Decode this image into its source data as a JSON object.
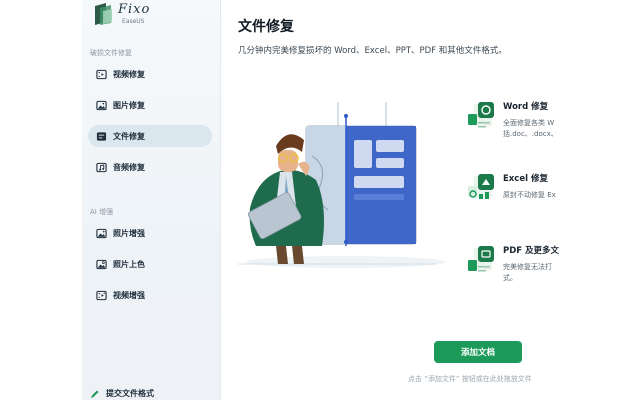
{
  "brand": {
    "name": "Fixo",
    "sub": "EaseUS"
  },
  "sidebar": {
    "section1": "破损文件修复",
    "section2": "AI 增强",
    "items": [
      {
        "label": "视频修复",
        "icon": "video-icon"
      },
      {
        "label": "图片修复",
        "icon": "image-icon"
      },
      {
        "label": "文件修复",
        "icon": "document-icon",
        "active": true
      },
      {
        "label": "音频修复",
        "icon": "audio-icon"
      },
      {
        "label": "照片增强",
        "icon": "photo-enhance-icon"
      },
      {
        "label": "照片上色",
        "icon": "photo-colorize-icon"
      },
      {
        "label": "视频增强",
        "icon": "video-enhance-icon"
      }
    ],
    "submit_format": "提交文件格式"
  },
  "main": {
    "title": "文件修复",
    "subtitle": "几分钟内完美修复损坏的 Word、Excel、PPT、PDF 和其他文件格式。",
    "features": [
      {
        "title": "Word 修复",
        "desc": "全面修复各类 W\n括.doc、.docx、",
        "icon": "word-icon"
      },
      {
        "title": "Excel 修复",
        "desc": "原封不动修复 Ex",
        "icon": "excel-icon"
      },
      {
        "title": "PDF 及更多文",
        "desc": "完美修复无法打\n式。",
        "icon": "pdf-icon"
      }
    ],
    "add_button": "添加文档",
    "hint": "点击 “添加文件” 按钮或在此处拖放文件"
  },
  "colors": {
    "accent": "#1c9a5a",
    "active_nav": "#dbe7ee"
  }
}
